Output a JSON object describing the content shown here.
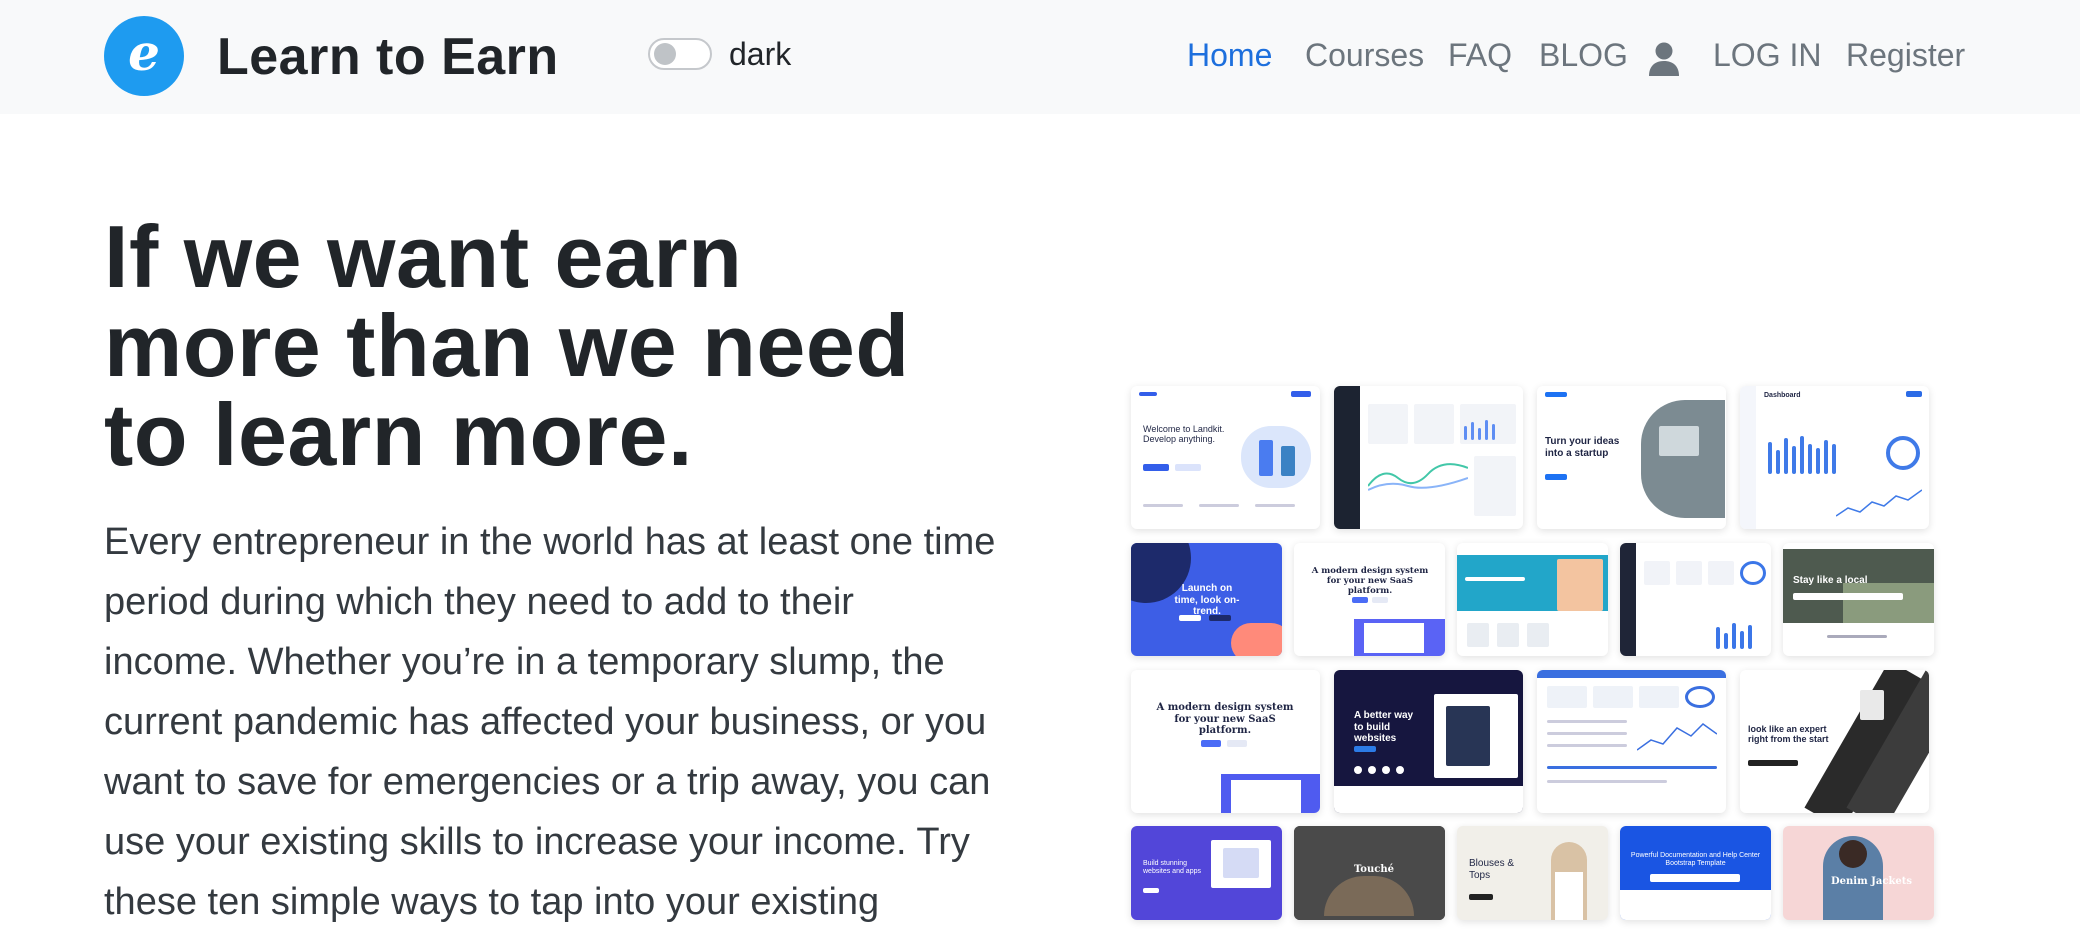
{
  "brand": {
    "logo_letter": "e",
    "name": "Learn to Earn",
    "accent_color": "#1e9bf0"
  },
  "theme_toggle": {
    "label": "dark",
    "state": "off"
  },
  "nav": {
    "items": [
      {
        "label": "Home",
        "active": true
      },
      {
        "label": "Courses",
        "active": false
      },
      {
        "label": "FAQ",
        "active": false
      },
      {
        "label": "BLOG",
        "active": false
      },
      {
        "label": "LOG IN",
        "active": false
      },
      {
        "label": "Register",
        "active": false
      }
    ],
    "user_icon": "user-icon",
    "active_color": "#1d6fdd"
  },
  "hero": {
    "headline_lines": [
      "If we want earn",
      "more than we need",
      "to learn more."
    ],
    "paragraph_lines": [
      "Every entrepreneur in the world has at least one time",
      "period during which they need to add to their",
      "income. Whether you’re in a temporary slump, the",
      "current pandemic has affected your business, or you",
      "want to save for emergencies or a trip away, you can",
      "use your existing skills to increase your income. Try",
      "these ten simple ways to tap into your existing"
    ]
  },
  "mockups": {
    "tiles": [
      {
        "title": "Welcome to Landkit. Develop anything."
      },
      {
        "title": ""
      },
      {
        "title": "Turn your ideas into a startup"
      },
      {
        "title": "Dashboard"
      },
      {
        "title": "Launch on time, look on-trend."
      },
      {
        "title": "A modern design system for your new SaaS platform."
      },
      {
        "title": ""
      },
      {
        "title": ""
      },
      {
        "title": "Stay like a local"
      },
      {
        "title": "A modern design system for your new SaaS platform."
      },
      {
        "title": "A better way to build websites"
      },
      {
        "title": ""
      },
      {
        "title": "look like an expert right from the start"
      },
      {
        "title": "Build stunning websites and apps"
      },
      {
        "title": "Touché"
      },
      {
        "title": "Blouses & Tops"
      },
      {
        "title": "Powerful Documentation and Help Center Bootstrap Template"
      },
      {
        "title": "Denim Jackets"
      }
    ]
  }
}
